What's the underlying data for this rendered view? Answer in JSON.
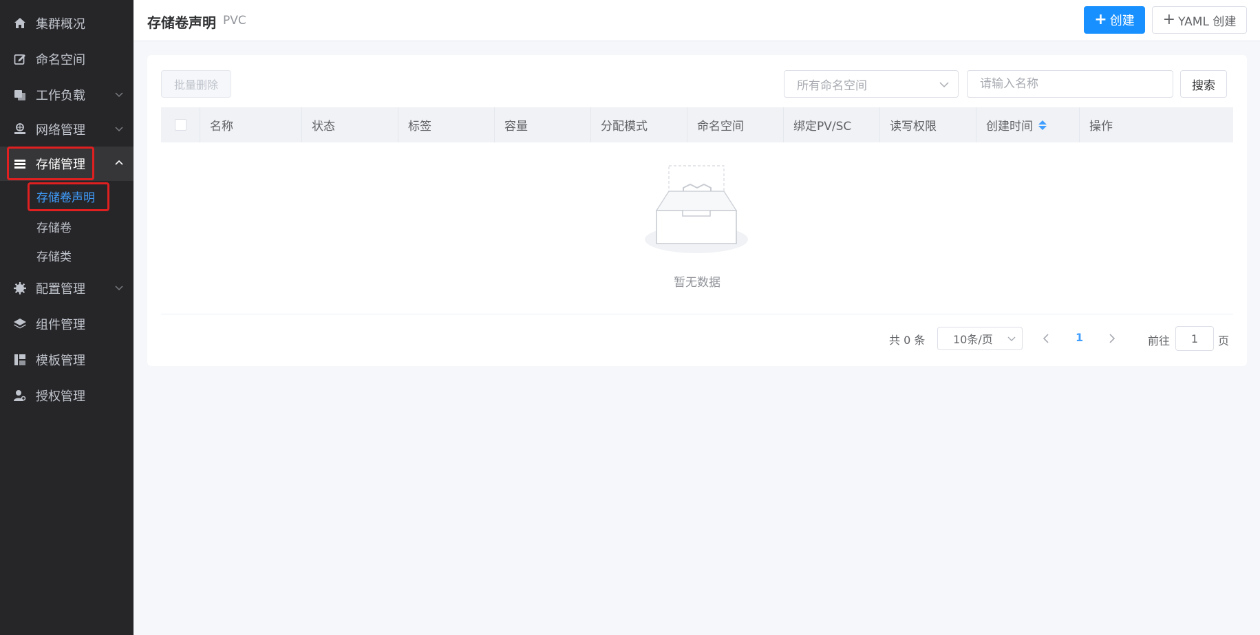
{
  "sidebar": {
    "items": [
      {
        "label": "集群概况",
        "icon": "home-icon"
      },
      {
        "label": "命名空间",
        "icon": "edit-icon"
      },
      {
        "label": "工作负载",
        "icon": "copy-icon"
      },
      {
        "label": "网络管理",
        "icon": "network-icon"
      },
      {
        "label": "存储管理",
        "icon": "storage-icon"
      },
      {
        "label": "配置管理",
        "icon": "gear-icon"
      },
      {
        "label": "组件管理",
        "icon": "layers-icon"
      },
      {
        "label": "模板管理",
        "icon": "template-icon"
      },
      {
        "label": "授权管理",
        "icon": "user-key-icon"
      }
    ],
    "storage_sub": [
      "存储卷声明",
      "存储卷",
      "存储类"
    ],
    "colors": {
      "background": "#262629",
      "active": "#363638",
      "current": "#409eff",
      "highlight": "#e02020"
    }
  },
  "header": {
    "title": "存储卷声明",
    "subtitle": "PVC",
    "create_label": "创建",
    "yaml_label": "YAML 创建"
  },
  "toolbar": {
    "batch_delete": "批量删除",
    "namespace_placeholder": "所有命名空间",
    "name_placeholder": "请输入名称",
    "search_label": "搜索"
  },
  "table": {
    "columns": [
      "名称",
      "状态",
      "标签",
      "容量",
      "分配模式",
      "命名空间",
      "绑定PV/SC",
      "读写权限",
      "创建时间",
      "操作"
    ],
    "empty_text": "暂无数据"
  },
  "pagination": {
    "total": "共 0 条",
    "page_size": "10条/页",
    "current_page": "1",
    "goto_label": "前往",
    "goto_value": "1",
    "page_suffix": "页"
  }
}
